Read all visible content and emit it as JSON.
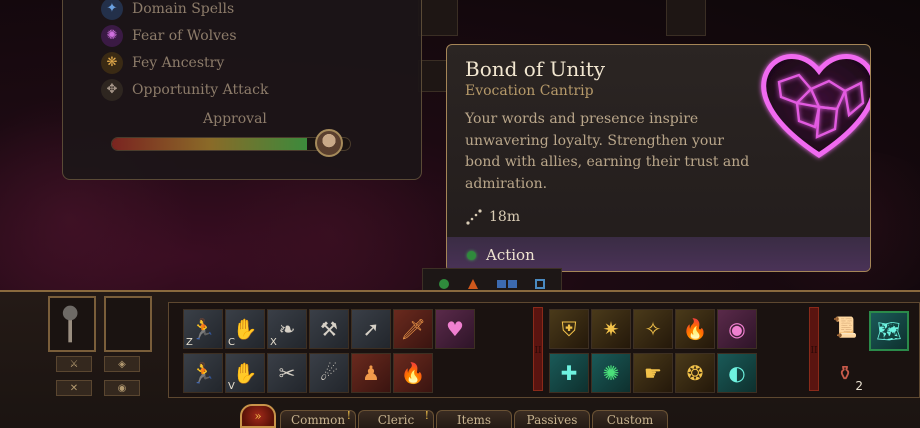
{
  "character_panel": {
    "features": [
      {
        "label": "Domain Spells",
        "icon": "domain-spells-icon",
        "color": "#4a7fc0"
      },
      {
        "label": "Fear of Wolves",
        "icon": "wolf-fear-icon",
        "color": "#b04ac0"
      },
      {
        "label": "Fey Ancestry",
        "icon": "fey-ancestry-icon",
        "color": "#c08a3a"
      },
      {
        "label": "Opportunity Attack",
        "icon": "opportunity-attack-icon",
        "color": "#8a7a6a"
      }
    ],
    "approval_label": "Approval",
    "approval_level": 0.82
  },
  "tooltip": {
    "title": "Bond of Unity",
    "subtitle": "Evocation Cantrip",
    "description": "Your words and presence inspire unwavering loyalty. Strengthen your bond with allies, earning their trust and admiration.",
    "range": "18m",
    "cost": "Action",
    "icon": "heart-icon",
    "accent": "#e04ae0"
  },
  "hotbar": {
    "key_z": "Z",
    "key_c": "C",
    "key_x": "X",
    "key_v": "V",
    "scroll_count": "2"
  },
  "tabs": [
    {
      "label": "Common",
      "alert": "!"
    },
    {
      "label": "Cleric",
      "alert": "!"
    },
    {
      "label": "Items",
      "alert": ""
    },
    {
      "label": "Passives",
      "alert": ""
    },
    {
      "label": "Custom",
      "alert": ""
    }
  ],
  "menu_button": "»"
}
